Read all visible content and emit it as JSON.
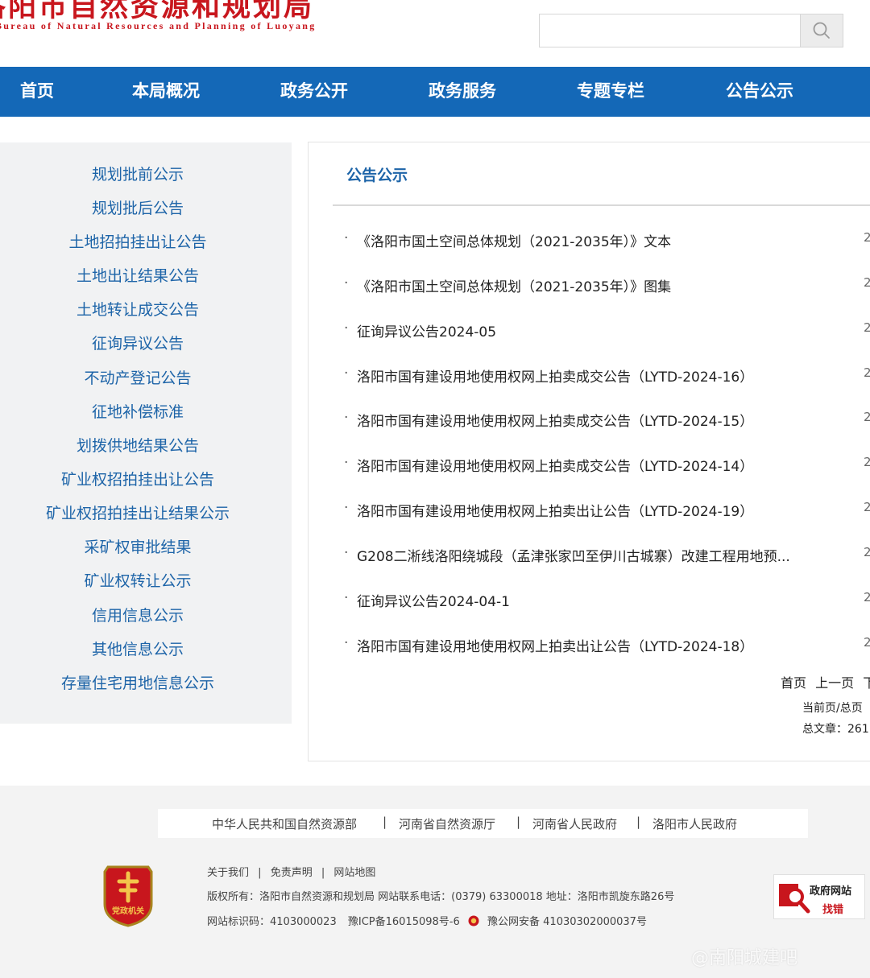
{
  "header": {
    "title": "洛阳市自然资源和规划局",
    "subtitle": "Bureau of Natural Resources and Planning of Luoyang",
    "search_placeholder": "",
    "search_icon": "search-icon"
  },
  "nav": {
    "items": [
      "首页",
      "本局概况",
      "政务公开",
      "政务服务",
      "专题专栏",
      "公告公示"
    ]
  },
  "sidebar": {
    "items": [
      "规划批前公示",
      "规划批后公告",
      "土地招拍挂出让公告",
      "土地出让结果公告",
      "土地转让成交公告",
      "征询异议公告",
      "不动产登记公告",
      "征地补偿标准",
      "划拨供地结果公告",
      "矿业权招拍挂出让公告",
      "矿业权招拍挂出让结果公示",
      "采矿权审批结果",
      "矿业权转让公示",
      "信用信息公示",
      "其他信息公示",
      "存量住宅用地信息公示"
    ]
  },
  "content": {
    "title": "公告公示",
    "bullet": "·",
    "items": [
      {
        "text": "《洛阳市国土空间总体规划（2021-2035年）》文本",
        "date": "2"
      },
      {
        "text": "《洛阳市国土空间总体规划（2021-2035年）》图集",
        "date": "2"
      },
      {
        "text": "征询异议公告2024-05",
        "date": "2"
      },
      {
        "text": "洛阳市国有建设用地使用权网上拍卖成交公告（LYTD-2024-16）",
        "date": "2"
      },
      {
        "text": "洛阳市国有建设用地使用权网上拍卖成交公告（LYTD-2024-15）",
        "date": "2"
      },
      {
        "text": "洛阳市国有建设用地使用权网上拍卖成交公告（LYTD-2024-14）",
        "date": "2"
      },
      {
        "text": "洛阳市国有建设用地使用权网上拍卖出让公告（LYTD-2024-19）",
        "date": "2"
      },
      {
        "text": "G208二淅线洛阳绕城段（孟津张家凹至伊川古城寨）改建工程用地预...",
        "date": "2"
      },
      {
        "text": "征询异议公告2024-04-1",
        "date": "2"
      },
      {
        "text": "洛阳市国有建设用地使用权网上拍卖出让公告（LYTD-2024-18）",
        "date": "2"
      }
    ],
    "pager": {
      "first": "首页",
      "prev": "上一页",
      "next": "下一",
      "current_page": "当前页/总页",
      "total": "总文章：261"
    }
  },
  "footer": {
    "links": [
      "中华人民共和国自然资源部",
      "河南省自然资源厅",
      "河南省人民政府",
      "洛阳市人民政府"
    ],
    "separator": "|",
    "about": "关于我们",
    "disclaimer": "免责声明",
    "sitemap": "网站地图",
    "copyright": "版权所有：洛阳市自然资源和规划局  网站联系电话：(0379) 63300018  地址：洛阳市凯旋东路26号",
    "site_id": "网站标识码：4103000023",
    "icp": "豫ICP备16015098号-6",
    "police": "豫公网安备 41030302000037号",
    "party_badge_text": "党政机关",
    "gov_badge_line1": "政府网站",
    "gov_badge_line2": "找错"
  },
  "watermark": "@南阳城建吧",
  "colors": {
    "brand_red": "#c8161d",
    "nav_blue": "#1468b7",
    "link_blue": "#1d64a8",
    "sidebar_bg": "#f1f2f3",
    "footer_bg": "#f3f3f3"
  }
}
